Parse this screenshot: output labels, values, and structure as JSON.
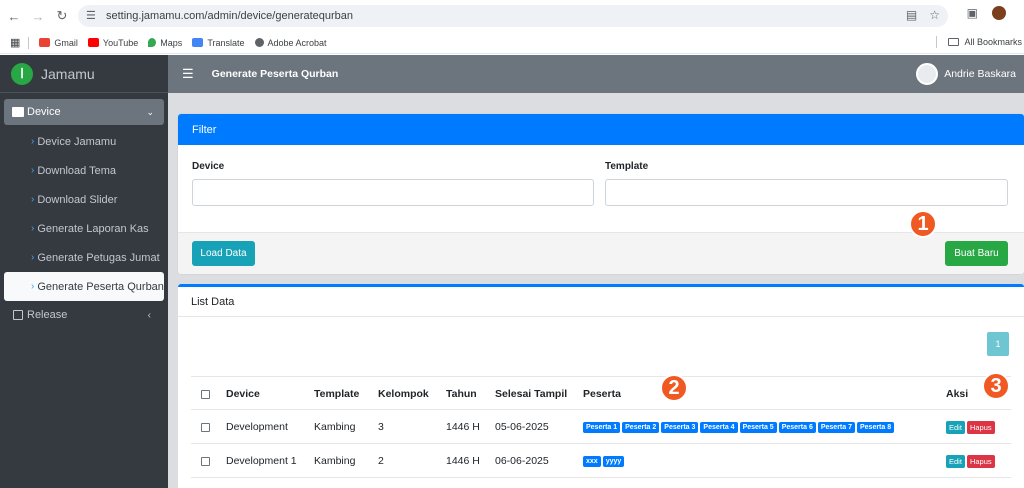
{
  "browser": {
    "url": "setting.jamamu.com/admin/device/generatequrban",
    "bookmarks": [
      "Gmail",
      "YouTube",
      "Maps",
      "Translate",
      "Adobe Acrobat"
    ],
    "all_bookmarks": "All Bookmarks"
  },
  "app": {
    "brand": "Jamamu",
    "page_title": "Generate Peserta Qurban",
    "user_name": "Andrie Baskara"
  },
  "sidebar": {
    "device_label": "Device",
    "items": [
      {
        "label": "Device Jamamu"
      },
      {
        "label": "Download Tema"
      },
      {
        "label": "Download Slider"
      },
      {
        "label": "Generate Laporan Kas"
      },
      {
        "label": "Generate Petugas Jumat"
      },
      {
        "label": "Generate Peserta Qurban"
      }
    ],
    "release_label": "Release"
  },
  "filter": {
    "title": "Filter",
    "device_label": "Device",
    "template_label": "Template",
    "load_button": "Load Data",
    "new_button": "Buat Baru"
  },
  "list": {
    "title": "List Data",
    "page": "1",
    "headers": {
      "device": "Device",
      "template": "Template",
      "kelompok": "Kelompok",
      "tahun": "Tahun",
      "selesai": "Selesai Tampil",
      "peserta": "Peserta",
      "aksi": "Aksi"
    },
    "rows": [
      {
        "device": "Development",
        "template": "Kambing",
        "kelompok": "3",
        "tahun": "1446 H",
        "selesai": "05-06-2025",
        "peserta": [
          "Peserta 1",
          "Peserta 2",
          "Peserta 3",
          "Peserta 4",
          "Peserta 5",
          "Peserta 6",
          "Peserta 7",
          "Peserta 8"
        ]
      },
      {
        "device": "Development 1",
        "template": "Kambing",
        "kelompok": "2",
        "tahun": "1446 H",
        "selesai": "06-06-2025",
        "peserta": [
          "xxx",
          "yyyy"
        ]
      }
    ],
    "edit_label": "Edit",
    "delete_label": "Hapus"
  },
  "markers": [
    "1",
    "2",
    "3"
  ],
  "colors": {
    "primary": "#007bff",
    "success": "#28a745",
    "info": "#17a2b8",
    "danger": "#dc3545",
    "sidebar": "#343a40",
    "marker": "#f05a22"
  }
}
